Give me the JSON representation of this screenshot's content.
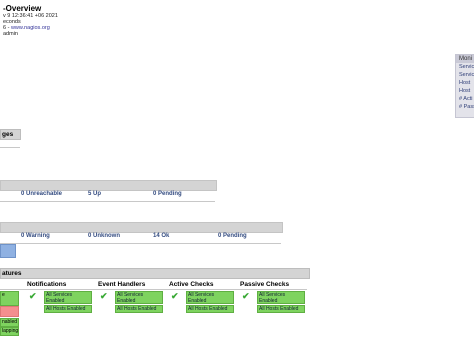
{
  "header": {
    "title": "-Overview",
    "timestamp": "v 9 12:36:41 +06 2021",
    "refresh": "econds",
    "version_prefix": "6 - ",
    "website": "www.nagios.org",
    "user": "admin"
  },
  "sections": {
    "pages": "ges",
    "features": "atures"
  },
  "host_status": {
    "unreachable": "0 Unreachable",
    "up": "5 Up",
    "pending": "0 Pending"
  },
  "service_status": {
    "warning": "0 Warning",
    "unknown": "0 Unknown",
    "ok": "14 Ok",
    "pending": "0 Pending"
  },
  "features": {
    "columns": [
      {
        "heading": "Notifications",
        "services": "All Services Enabled",
        "hosts": "All Hosts Enabled"
      },
      {
        "heading": "Event Handlers",
        "services": "All Services Enabled",
        "hosts": "All Hosts Enabled"
      },
      {
        "heading": "Active Checks",
        "services": "All Services Enabled",
        "hosts": "All Hosts Enabled"
      },
      {
        "heading": "Passive Checks",
        "services": "All Services Enabled",
        "hosts": "All Hosts Enabled"
      }
    ],
    "left_labels": [
      "e",
      "nabled",
      "lapping"
    ]
  },
  "monitor_panel": {
    "title": "Moni",
    "items": [
      "Servic",
      "Servic",
      "Host",
      "Host",
      "# Acti",
      "# Pass"
    ]
  },
  "colors": {
    "enabled_green": "#7ed35f",
    "check_green": "#39a935",
    "link_blue": "#334b80",
    "problem_red": "#f48f8f"
  }
}
